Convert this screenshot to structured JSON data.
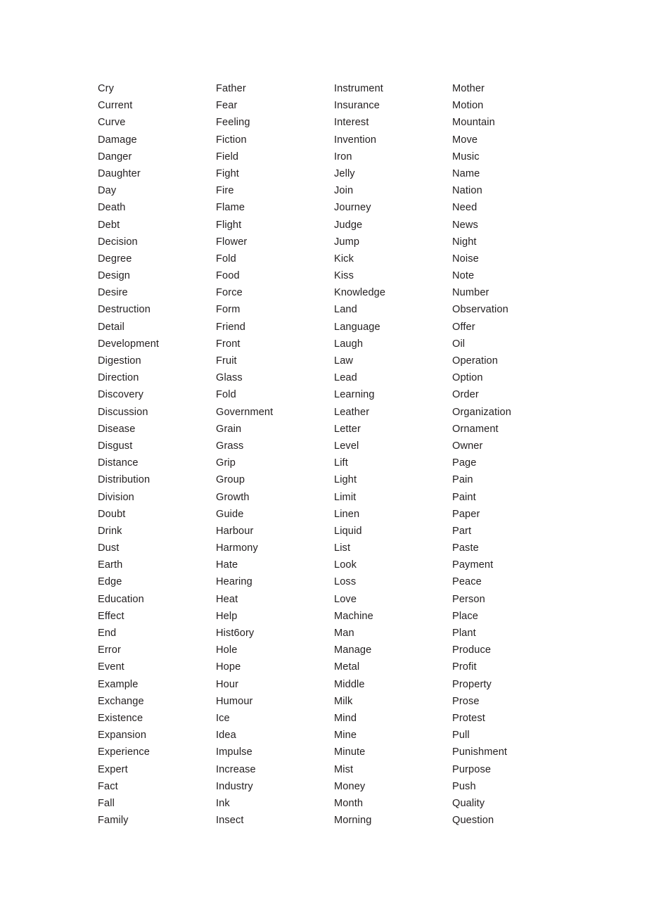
{
  "document": {
    "type": "word-list",
    "layout": "four-column",
    "row_count": 44,
    "column_count": 4,
    "text_color": "#231f20",
    "background_color": "#ffffff"
  },
  "columns": [
    {
      "index": 1,
      "name": "column-1",
      "words": [
        "Cry",
        "Current",
        "Curve",
        "Damage",
        "Danger",
        "Daughter",
        "Day",
        "Death",
        "Debt",
        "Decision",
        "Degree",
        "Design",
        "Desire",
        "Destruction",
        "Detail",
        "Development",
        "Digestion",
        "Direction",
        "Discovery",
        "Discussion",
        "Disease",
        "Disgust",
        "Distance",
        "Distribution",
        "Division",
        "Doubt",
        "Drink",
        "Dust",
        "Earth",
        "Edge",
        "Education",
        "Effect",
        "End",
        "Error",
        "Event",
        "Example",
        "Exchange",
        "Existence",
        "Expansion",
        "Experience",
        "Expert",
        "Fact",
        "Fall",
        "Family"
      ]
    },
    {
      "index": 2,
      "name": "column-2",
      "words": [
        "Father",
        "Fear",
        "Feeling",
        "Fiction",
        "Field",
        "Fight",
        "Fire",
        "Flame",
        "Flight",
        "Flower",
        "Fold",
        "Food",
        "Force",
        "Form",
        "Friend",
        "Front",
        "Fruit",
        "Glass",
        "Fold",
        "Government",
        "Grain",
        "Grass",
        "Grip",
        "Group",
        "Growth",
        "Guide",
        "Harbour",
        "Harmony",
        "Hate",
        "Hearing",
        "Heat",
        "Help",
        "Hist6ory",
        "Hole",
        "Hope",
        "Hour",
        "Humour",
        "Ice",
        "Idea",
        "Impulse",
        "Increase",
        "Industry",
        "Ink",
        "Insect"
      ]
    },
    {
      "index": 3,
      "name": "column-3",
      "words": [
        "Instrument",
        "Insurance",
        "Interest",
        "Invention",
        "Iron",
        "Jelly",
        "Join",
        "Journey",
        "Judge",
        "Jump",
        "Kick",
        "Kiss",
        "Knowledge",
        "Land",
        "Language",
        "Laugh",
        "Law",
        "Lead",
        "Learning",
        "Leather",
        "Letter",
        "Level",
        "Lift",
        "Light",
        "Limit",
        "Linen",
        "Liquid",
        "List",
        "Look",
        "Loss",
        "Love",
        "Machine",
        "Man",
        "Manage",
        "Metal",
        "Middle",
        "Milk",
        "Mind",
        "Mine",
        "Minute",
        "Mist",
        "Money",
        "Month",
        "Morning"
      ]
    },
    {
      "index": 4,
      "name": "column-4",
      "words": [
        "Mother",
        "Motion",
        "Mountain",
        "Move",
        "Music",
        "Name",
        "Nation",
        "Need",
        "News",
        "Night",
        "Noise",
        "Note",
        "Number",
        "Observation",
        "Offer",
        "Oil",
        "Operation",
        "Option",
        "Order",
        "Organization",
        "Ornament",
        "Owner",
        "Page",
        "Pain",
        "Paint",
        "Paper",
        "Part",
        "Paste",
        "Payment",
        "Peace",
        "Person",
        "Place",
        "Plant",
        "Produce",
        "Profit",
        "Property",
        "Prose",
        "Protest",
        "Pull",
        "Punishment",
        "Purpose",
        "Push",
        "Quality",
        "Question"
      ]
    }
  ]
}
